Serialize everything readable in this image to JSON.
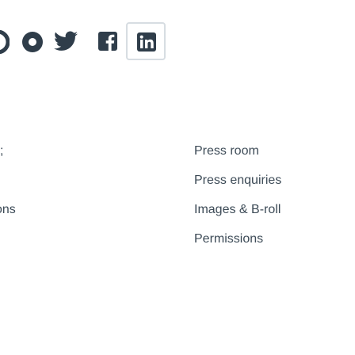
{
  "social_icons": [
    {
      "name": "partial-icon"
    },
    {
      "name": "circle-icon"
    },
    {
      "name": "twitter-icon"
    },
    {
      "name": "facebook-icon"
    },
    {
      "name": "linkedin-icon"
    }
  ],
  "left_column": {
    "item_1": ";",
    "item_3": "ons"
  },
  "links": [
    {
      "label": "Press room"
    },
    {
      "label": "Press enquiries"
    },
    {
      "label": "Images & B-roll"
    },
    {
      "label": "Permissions"
    }
  ],
  "colors": {
    "text": "#3d4b57",
    "icon": "#2f3d4a",
    "border": "#d7dde2"
  }
}
